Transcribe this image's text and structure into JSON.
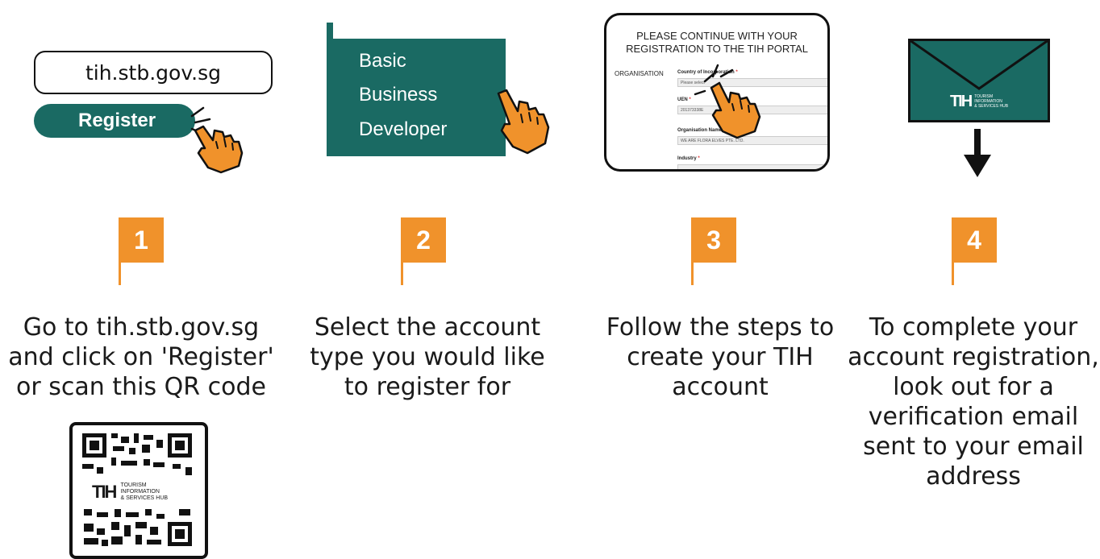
{
  "colors": {
    "teal": "#1a6a63",
    "orange": "#f0922b",
    "hand": "#f0922b"
  },
  "step1": {
    "url": "tih.stb.gov.sg",
    "register_label": "Register",
    "number": "1",
    "text_lines": [
      "Go to tih.stb.gov.sg",
      "and click on 'Register'",
      "or scan this QR code"
    ],
    "qr_logo_mark": "TIH",
    "qr_logo_lines": [
      "TOURISM",
      "INFORMATION",
      "& SERVICES HUB"
    ]
  },
  "step2": {
    "account_types": [
      "Basic",
      "Business",
      "Developer"
    ],
    "number": "2",
    "text_lines": [
      "Select the account",
      "type you would like",
      "to register for"
    ]
  },
  "step3": {
    "portal_title_lines": [
      "PLEASE CONTINUE WITH YOUR",
      "REGISTRATION TO THE TIH PORTAL"
    ],
    "section_label": "ORGANISATION",
    "fields": [
      {
        "label": "Country of Incorporation",
        "required": "*",
        "value": "Please select"
      },
      {
        "label": "UEN",
        "required": "*",
        "value": "201373338E"
      },
      {
        "label": "Organisation Name",
        "required": "*",
        "value": "WE ARE FLORA ELVES PTE. LTD."
      },
      {
        "label": "Industry",
        "required": "*",
        "value": ""
      }
    ],
    "number": "3",
    "text_lines": [
      "Follow the steps to",
      "create your TIH",
      "account"
    ]
  },
  "step4": {
    "envelope_logo_mark": "TIH",
    "envelope_logo_lines": [
      "TOURISM",
      "INFORMATION",
      "& SERVICES HUB"
    ],
    "number": "4",
    "text_lines": [
      "To complete your",
      "account registration,",
      "look out for a",
      "verification email",
      "sent to your email",
      "address"
    ]
  }
}
